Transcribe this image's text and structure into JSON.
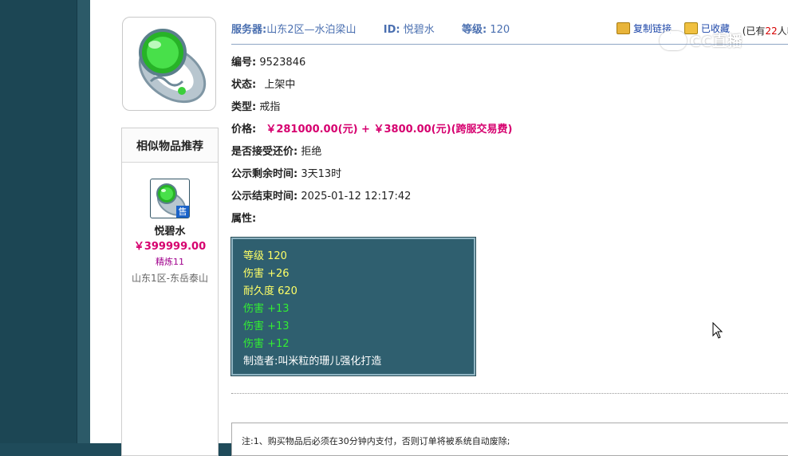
{
  "item": {
    "server_label": "服务器:",
    "server_value": "山东2区—水泊梁山",
    "id_label": "ID:",
    "id_value": "悦碧水",
    "level_label": "等级:",
    "level_value": "120"
  },
  "actions": {
    "copy_link": "复制链接",
    "favorited": "已收藏",
    "fav_prefix": "(已有",
    "fav_count": "22",
    "fav_suffix": "人收"
  },
  "watermark": {
    "text": "CC直播"
  },
  "details": {
    "number_label": "编号:",
    "number_value": "9523846",
    "status_label": "状态:",
    "status_value": "上架中",
    "type_label": "类型:",
    "type_value": "戒指",
    "price_label": "价格:",
    "price_value": "￥281000.00(元) + ￥3800.00(元)(跨服交易费)",
    "counter_label": "是否接受还价:",
    "counter_value": "拒绝",
    "remaining_label": "公示剩余时间:",
    "remaining_value": "3天13时",
    "end_label": "公示结束时间:",
    "end_value": "2025-01-12 12:17:42",
    "attributes_label": "属性:"
  },
  "attributes": [
    {
      "text": "等级 120"
    },
    {
      "text": "伤害 +26"
    },
    {
      "text": "耐久度 620"
    },
    {
      "text": "伤害 +13"
    },
    {
      "text": "伤害 +13"
    },
    {
      "text": "伤害 +12"
    },
    {
      "text": "制造者:叫米粒的珊儿强化打造"
    }
  ],
  "recommend": {
    "title": "相似物品推荐",
    "badge": "售",
    "name": "悦碧水",
    "price": "￥399999.00",
    "refine": "精炼11",
    "server": "山东1区-东岳泰山"
  },
  "notice": {
    "text": "注:1、购买物品后必须在30分钟内支付，否则订单将被系统自动废除;"
  },
  "colors": {
    "attr_bg": "#2f5f6f",
    "price": "#d6006f",
    "header_text": "#4a6fb0"
  }
}
